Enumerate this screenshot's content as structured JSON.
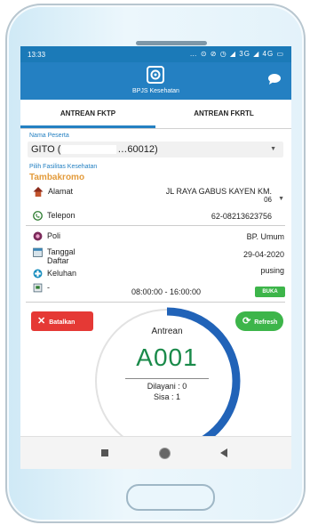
{
  "status_bar": {
    "time": "13:33",
    "icons_text": "… ⊙ ⊘ ◷ ◢ 3G ◢ 4G ▭"
  },
  "app": {
    "name": "BPJS Kesehatan"
  },
  "tabs": [
    {
      "label": "ANTREAN FKTP",
      "active": true
    },
    {
      "label": "ANTREAN FKRTL",
      "active": false
    }
  ],
  "peserta": {
    "label": "Nama Peserta",
    "value_prefix": "GITO (",
    "value_suffix": "…60012)"
  },
  "faskes": {
    "label": "Pilih Fasilitas Kesehatan",
    "name": "Tambakromo"
  },
  "alamat": {
    "label": "Alamat",
    "value_line1": "JL RAYA GABUS KAYEN KM.",
    "value_line2": "06"
  },
  "telepon": {
    "label": "Telepon",
    "value": "62-08213623756"
  },
  "poli": {
    "label": "Poli",
    "value": "BP. Umum"
  },
  "tanggal": {
    "label_line1": "Tanggal",
    "label_line2": "Daftar",
    "value": "29-04-2020"
  },
  "keluhan": {
    "label": "Keluhan",
    "value": "pusing"
  },
  "jam": {
    "label": "-",
    "value": "08:00:00 - 16:00:00",
    "status": "BUKA"
  },
  "buttons": {
    "batalkan": "Batalkan",
    "refresh": "Refresh"
  },
  "antrean": {
    "label": "Antrean",
    "number": "A001",
    "dilayani": "Dilayani : 0",
    "sisa": "Sisa : 1",
    "progress_fraction": 0.5
  },
  "colors": {
    "primary": "#2480c2",
    "accent_orange": "#e39b3b",
    "success": "#3db54a",
    "danger": "#e53935",
    "queue_green": "#1a8a4a"
  },
  "icons": [
    "bpjs-logo-icon",
    "chat-icon",
    "dropdown-icon",
    "house-icon",
    "phone-icon",
    "poli-icon",
    "calendar-icon",
    "keluhan-icon",
    "clock-icon",
    "close-icon",
    "refresh-icon"
  ]
}
